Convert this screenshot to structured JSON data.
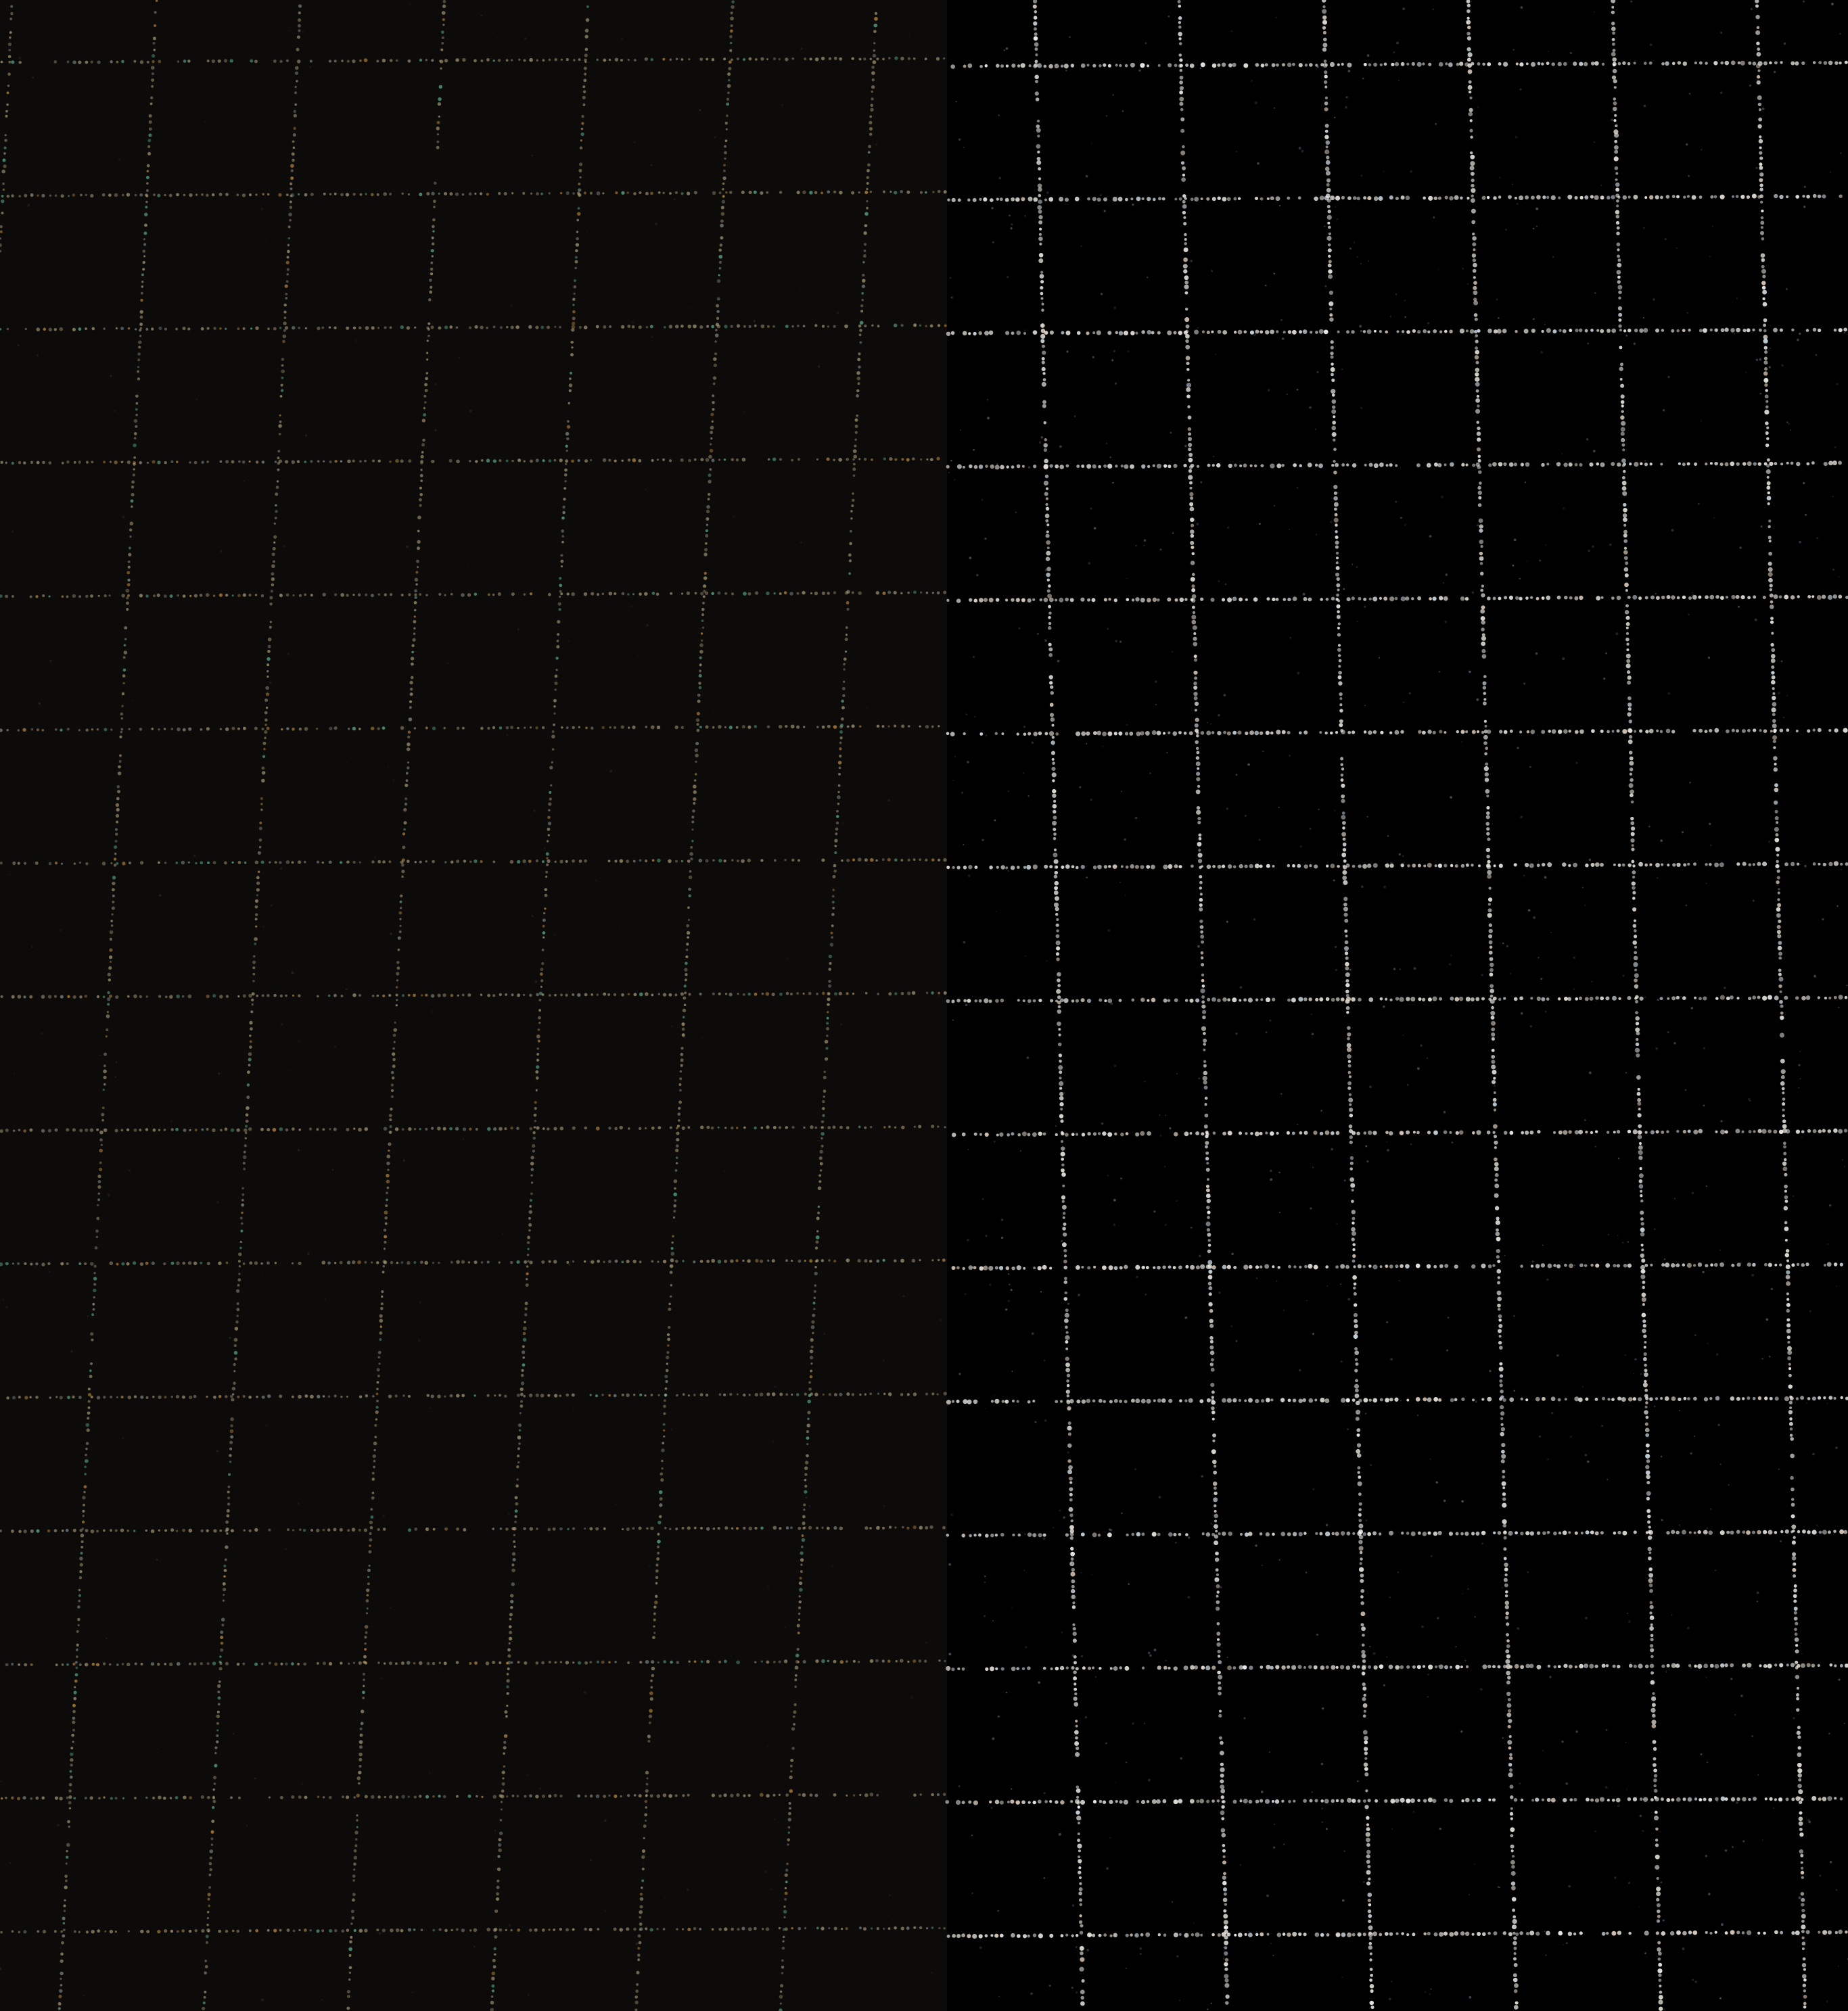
{
  "scene": {
    "description_kind": "photo-comparison",
    "panels": [
      {
        "id": "left",
        "background": "#0c0b0a",
        "grid_color": "#c7b58c",
        "accent_colors": [
          "#e3a54a",
          "#6fd0a8",
          "#9aa6a0"
        ],
        "columns": 6,
        "rows": 15,
        "dash_pattern": "dotted-tinsel"
      },
      {
        "id": "right",
        "background": "#000000",
        "grid_color": "#f2eee6",
        "accent_colors": [
          "#ffffff",
          "#e9d7c6",
          "#d7e3ec"
        ],
        "columns": 6,
        "rows": 15,
        "dash_pattern": "dotted-bright"
      }
    ]
  }
}
